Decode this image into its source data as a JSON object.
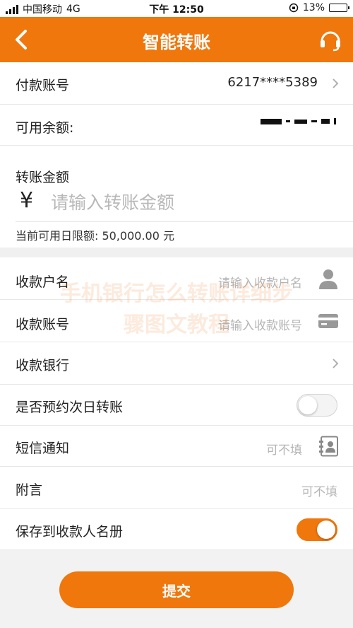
{
  "status": {
    "carrier": "中国移动",
    "network": "4G",
    "time": "下午 12:50",
    "battery": "13%",
    "battery_level": 0.13
  },
  "header": {
    "title": "智能转账"
  },
  "payer": {
    "label": "付款账号",
    "value": "6217****5389"
  },
  "balance": {
    "label": "可用余额:"
  },
  "amount": {
    "label": "转账金额",
    "currency": "¥",
    "placeholder": "请输入转账金额",
    "limit": "当前可用日限额: 50,000.00 元"
  },
  "payee_name": {
    "label": "收款户名",
    "placeholder": "请输入收款户名"
  },
  "payee_account": {
    "label": "收款账号",
    "placeholder": "请输入收款账号"
  },
  "payee_bank": {
    "label": "收款银行"
  },
  "schedule": {
    "label": "是否预约次日转账",
    "enabled": false
  },
  "sms": {
    "label": "短信通知",
    "placeholder": "可不填"
  },
  "note": {
    "label": "附言",
    "placeholder": "可不填"
  },
  "save_payee": {
    "label": "保存到收款人名册",
    "enabled": true
  },
  "submit": {
    "label": "提交"
  },
  "watermark": {
    "line1": "手机银行怎么转账详细步",
    "line2": "骤图文教程"
  },
  "colors": {
    "accent": "#f0770c",
    "placeholder": "#b5b5b5"
  }
}
